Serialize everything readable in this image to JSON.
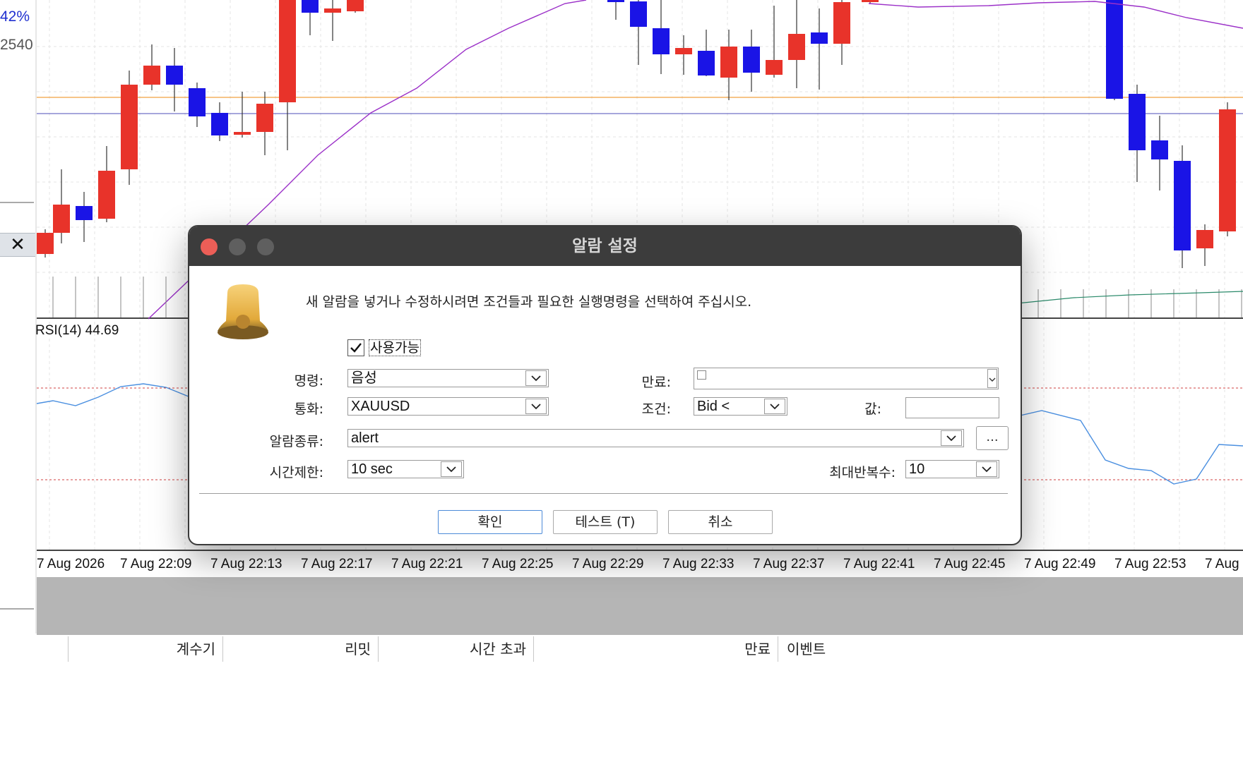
{
  "chart": {
    "price_labels": [
      "42%",
      "2540"
    ],
    "rsi_label": "RSI(14) 44.69",
    "x_axis_labels": [
      "7 Aug 2026",
      "7 Aug 22:09",
      "7 Aug 22:13",
      "7 Aug 22:17",
      "7 Aug 22:21",
      "7 Aug 22:25",
      "7 Aug 22:29",
      "7 Aug 22:33",
      "7 Aug 22:37",
      "7 Aug 22:41",
      "7 Aug 22:45",
      "7 Aug 22:49",
      "7 Aug 22:53",
      "7 Aug"
    ],
    "colors": {
      "bull": "#e8332a",
      "bear": "#1a14e6",
      "ma": "#9b30c8",
      "rsi": "#4a8fe0",
      "level_orange": "#f0a040",
      "level_blue": "#7070c8"
    },
    "close_icon": "✕"
  },
  "bottom_table": {
    "columns": [
      "계수기",
      "리밋",
      "시간 초과",
      "만료",
      "이벤트"
    ]
  },
  "dialog": {
    "title": "알람 설정",
    "description": "새 알람을 넣거나 수정하시려면 조건들과 필요한 실행명령을 선택하여 주십시오.",
    "enabled_label": "사용가능",
    "enabled": true,
    "command_label": "명령:",
    "command_value": "음성",
    "symbol_label": "통화:",
    "symbol_value": "XAUUSD",
    "alarm_type_label": "알람종류:",
    "alarm_type_value": "alert",
    "timeout_label": "시간제한:",
    "timeout_value": "10 sec",
    "expiry_label": "만료:",
    "condition_label": "조건:",
    "condition_value": "Bid <",
    "value_label": "값:",
    "value_value": "",
    "max_repeat_label": "최대반복수:",
    "max_repeat_value": "10",
    "dots_label": "...",
    "ok_label": "확인",
    "test_label": "테스트 (T)",
    "cancel_label": "취소"
  }
}
